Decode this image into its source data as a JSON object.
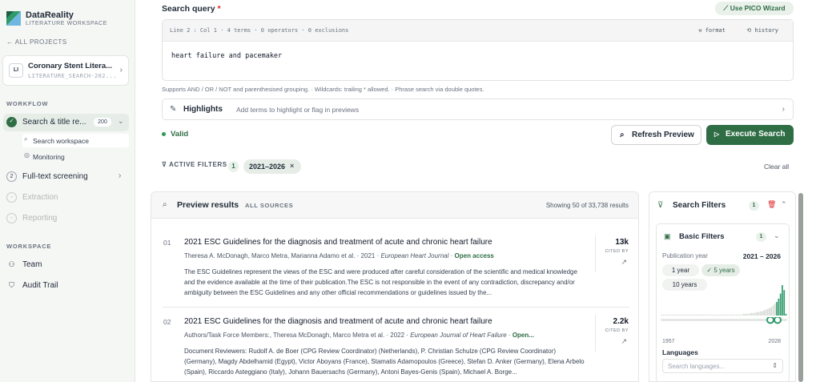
{
  "brand": {
    "name": "DataReality",
    "subtitle": "LITERATURE WORKSPACE"
  },
  "nav_back": "ALL PROJECTS",
  "project": {
    "initials": "LI",
    "title": "Coronary Stent Litera...",
    "subtitle": "LITERATURE_SEARCH-202..."
  },
  "sidebar": {
    "workflow_label": "WORKFLOW",
    "search_title": "Search & title re...",
    "search_count": "200",
    "sub_items": [
      "Search workspace",
      "Monitoring"
    ],
    "fulltext_num": "2",
    "fulltext": "Full-text screening",
    "extraction": "Extraction",
    "reporting": "Reporting",
    "workspace_label": "WORKSPACE",
    "team": "Team",
    "audit": "Audit Trail"
  },
  "search": {
    "label": "Search query",
    "required_mark": "*",
    "pico_button": "Use PICO Wizard",
    "status": "Line 2 : Col 1  ·  4 terms  ·  0 operators  ·  0 exclusions",
    "format": "format",
    "history": "history",
    "query": "heart failure and pacemaker",
    "help": "Supports AND / OR / NOT and parenthesised grouping. · Wildcards: trailing * allowed. · Phrase search via double quotes.",
    "highlights_title": "Highlights",
    "highlights_sub": "Add terms to highlight or flag in previews",
    "valid": "Valid",
    "refresh": "Refresh Preview",
    "execute": "Execute Search"
  },
  "filters_bar": {
    "label": "ACTIVE FILTERS",
    "count": "1",
    "chip": "2021–2026",
    "clear": "Clear all"
  },
  "results": {
    "title": "Preview results",
    "source": "ALL SOURCES",
    "count": "Showing 50 of 33,738 results",
    "items": [
      {
        "num": "01",
        "title": "2021 ESC Guidelines for the diagnosis and treatment of acute and chronic heart failure",
        "authors": "Theresa A. McDonagh, Marco Metra, Marianna Adamo et al.",
        "year": "2021",
        "journal": "European Heart Journal",
        "access": "Open access",
        "abstract": "The ESC Guidelines represent the views of the ESC and were produced after careful consideration of the scientific and medical knowledge and the evidence available at the time of their publication.The ESC is not responsible in the event of any contradiction, discrepancy and/or ambiguity between the ESC Guidelines and any other official recommendations or guidelines issued by the...",
        "cites": "13k",
        "cites_label": "CITED BY"
      },
      {
        "num": "02",
        "title": "2021 ESC Guidelines for the diagnosis and treatment of acute and chronic heart failure",
        "authors": "Authors/Task Force Members:, Theresa McDonagh, Marco Metra et al.",
        "year": "2022",
        "journal": "European Journal of Heart Failure",
        "access": "Open...",
        "abstract": "Document Reviewers: Rudolf A. de Boer (CPG Review Coordinator) (Netherlands), P. Christian Schulze (CPG Review Coordinator) (Germany), Magdy Abdelhamid (Egypt), Victor Aboyans (France), Stamatis Adamopoulos (Greece), Stefan D. Anker (Germany), Elena Arbelo (Spain), Riccardo Asteggiano (Italy), Johann Bauersachs (Germany), Antoni Bayes-Genis (Spain), Michael A. Borge...",
        "cites": "2.2k",
        "cites_label": "CITED BY"
      }
    ]
  },
  "filters_panel": {
    "title": "Search Filters",
    "count": "1",
    "basic_title": "Basic Filters",
    "basic_count": "1",
    "pub_year_label": "Publication year",
    "pub_year_range": "2021 – 2026",
    "presets": [
      "1 year",
      "5 years",
      "10 years"
    ],
    "year_min": "1957",
    "year_max": "2028",
    "histogram": [
      1,
      1,
      1,
      1,
      1,
      1,
      1,
      1,
      1,
      1,
      1,
      1,
      1,
      1,
      1,
      1,
      1,
      1,
      1,
      1,
      1,
      1,
      1,
      1,
      1,
      1,
      1,
      1,
      1,
      1,
      1,
      1,
      1,
      1,
      1,
      1,
      1,
      1,
      1,
      1,
      1,
      1,
      1,
      1,
      1,
      2,
      2,
      2,
      2,
      3,
      3,
      3,
      4,
      4,
      5,
      5,
      6,
      7,
      8,
      9,
      10,
      12,
      14,
      16,
      20,
      26,
      36,
      30,
      2
    ],
    "languages_label": "Languages",
    "languages_placeholder": "Search languages..."
  },
  "colors": {
    "accent": "#2f6d45",
    "danger": "#dc2626"
  }
}
